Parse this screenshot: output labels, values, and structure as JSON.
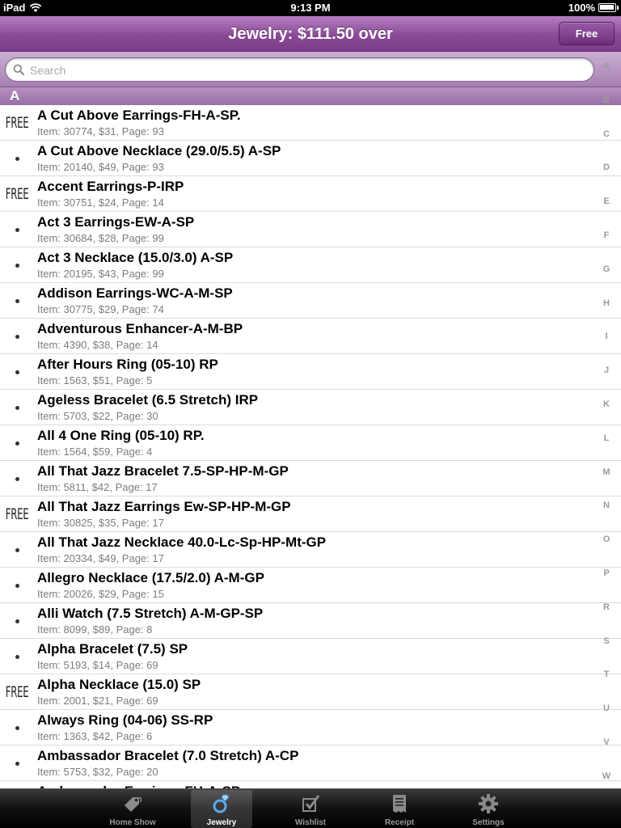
{
  "status_bar": {
    "device": "iPad",
    "time": "9:13 PM",
    "battery": "100%",
    "battery_level": 1.0
  },
  "nav": {
    "title": "Jewelry: $111.50 over",
    "free_button": "Free"
  },
  "search": {
    "placeholder": "Search"
  },
  "section": "A",
  "rows": [
    {
      "mark": "FREE",
      "name": "A Cut Above Earrings-FH-A-SP.",
      "detail": "Item: 30774, $31, Page: 93"
    },
    {
      "mark": "dot",
      "name": "A Cut Above Necklace (29.0/5.5) A-SP",
      "detail": "Item: 20140, $49, Page: 93"
    },
    {
      "mark": "FREE",
      "name": "Accent Earrings-P-IRP",
      "detail": "Item: 30751, $24, Page: 14"
    },
    {
      "mark": "dot",
      "name": "Act 3 Earrings-EW-A-SP",
      "detail": "Item: 30684, $28, Page: 99"
    },
    {
      "mark": "dot",
      "name": "Act 3 Necklace (15.0/3.0) A-SP",
      "detail": "Item: 20195, $43, Page: 99"
    },
    {
      "mark": "dot",
      "name": "Addison Earrings-WC-A-M-SP",
      "detail": "Item: 30775, $29, Page: 74"
    },
    {
      "mark": "dot",
      "name": "Adventurous Enhancer-A-M-BP",
      "detail": "Item: 4390, $38, Page: 14"
    },
    {
      "mark": "dot",
      "name": "After Hours Ring (05-10) RP",
      "detail": "Item: 1563, $51, Page: 5"
    },
    {
      "mark": "dot",
      "name": "Ageless Bracelet (6.5 Stretch) IRP",
      "detail": "Item: 5703, $22, Page: 30"
    },
    {
      "mark": "dot",
      "name": "All 4 One Ring (05-10) RP.",
      "detail": "Item: 1564, $59, Page: 4"
    },
    {
      "mark": "dot",
      "name": "All That Jazz Bracelet 7.5-SP-HP-M-GP",
      "detail": "Item: 5811, $42, Page: 17"
    },
    {
      "mark": "FREE",
      "name": "All That Jazz Earrings Ew-SP-HP-M-GP",
      "detail": "Item: 30825, $35, Page: 17"
    },
    {
      "mark": "dot",
      "name": "All That Jazz Necklace 40.0-Lc-Sp-HP-Mt-GP",
      "detail": "Item: 20334, $49, Page: 17"
    },
    {
      "mark": "dot",
      "name": "Allegro Necklace (17.5/2.0) A-M-GP",
      "detail": "Item: 20026, $29, Page: 15"
    },
    {
      "mark": "dot",
      "name": "Alli Watch (7.5 Stretch) A-M-GP-SP",
      "detail": "Item: 8099, $89, Page: 8"
    },
    {
      "mark": "dot",
      "name": "Alpha Bracelet (7.5) SP",
      "detail": "Item: 5193, $14, Page: 69"
    },
    {
      "mark": "FREE",
      "name": "Alpha Necklace (15.0) SP",
      "detail": "Item: 2001, $21, Page: 69"
    },
    {
      "mark": "dot",
      "name": "Always Ring (04-06) SS-RP",
      "detail": "Item: 1363, $42, Page: 6"
    },
    {
      "mark": "dot",
      "name": "Ambassador Bracelet (7.0 Stretch) A-CP",
      "detail": "Item: 5753, $32, Page: 20"
    },
    {
      "mark": "dot",
      "name": "Ambassador Earrings-FH-A-SP",
      "detail": ""
    }
  ],
  "index_letters": [
    "A",
    "B",
    "C",
    "D",
    "E",
    "F",
    "G",
    "H",
    "I",
    "J",
    "K",
    "L",
    "M",
    "N",
    "O",
    "P",
    "R",
    "S",
    "T",
    "U",
    "V",
    "W"
  ],
  "tabs": [
    {
      "label": "Home Show",
      "icon": "price-tag-icon",
      "active": false
    },
    {
      "label": "Jewelry",
      "icon": "ring-icon",
      "active": true
    },
    {
      "label": "Wishlist",
      "icon": "checkbox-icon",
      "active": false
    },
    {
      "label": "Receipt",
      "icon": "receipt-icon",
      "active": false
    },
    {
      "label": "Settings",
      "icon": "gear-icon",
      "active": false
    }
  ]
}
